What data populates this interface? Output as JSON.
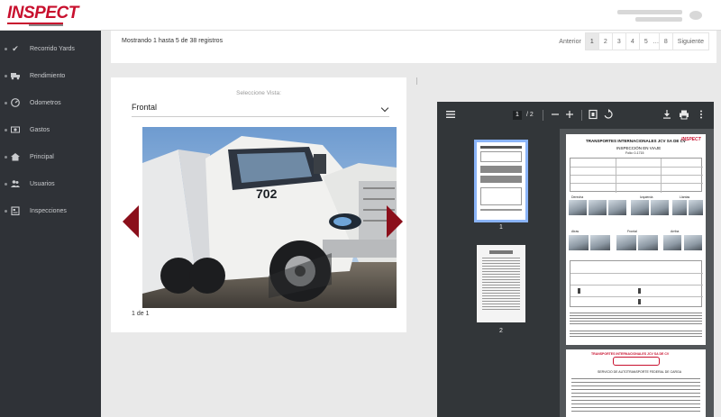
{
  "app": {
    "logo": "INSPECT"
  },
  "colors": {
    "brand": "#c8102e",
    "sidebar": "#2f3237",
    "arrow": "#8b0f1b",
    "pdf_toolbar": "#323639"
  },
  "sidebar": {
    "items": [
      {
        "label": "Recorrido Yards",
        "icon": "check-icon"
      },
      {
        "label": "Rendimiento",
        "icon": "truck-icon"
      },
      {
        "label": "Odometros",
        "icon": "gauge-icon"
      },
      {
        "label": "Gastos",
        "icon": "money-icon"
      },
      {
        "label": "Principal",
        "icon": "home-icon"
      },
      {
        "label": "Usuarios",
        "icon": "users-icon"
      },
      {
        "label": "Inspecciones",
        "icon": "clipboard-icon"
      }
    ]
  },
  "pager": {
    "records_text": "Mostrando 1 hasta 5 de 38 registros",
    "prev": "Anterior",
    "pages": [
      "1",
      "2",
      "3",
      "4",
      "5"
    ],
    "ellipsis": "…",
    "last": "8",
    "next": "Siguiente",
    "active_page": "1"
  },
  "photo_viewer": {
    "label": "Seleccione Vista:",
    "selected_view": "Frontal",
    "counter": "1 de 1",
    "truck_number": "702"
  },
  "pdf_viewer": {
    "current_page": "1",
    "total_pages": "/ 2",
    "thumbs": [
      {
        "num": "1"
      },
      {
        "num": "2"
      }
    ],
    "page1": {
      "company": "TRANSPORTES INTERNACIONALES JCV SA DE CV",
      "logo": "INSPECT",
      "subtitle": "INSPECCIÓN EN VIAJE",
      "folio": "Folio: 0-1715",
      "photo_labels": [
        "Derecha",
        "Izquierda",
        "Llantas",
        "Atras",
        "Frontal",
        "Arriba"
      ]
    },
    "page2": {
      "header": "TRANSPORTES INTERNACIONALES JCV SA DE CV",
      "service": "SERVICIO DE AUTOTRANSPORTE FEDERAL DE CARGA"
    }
  }
}
